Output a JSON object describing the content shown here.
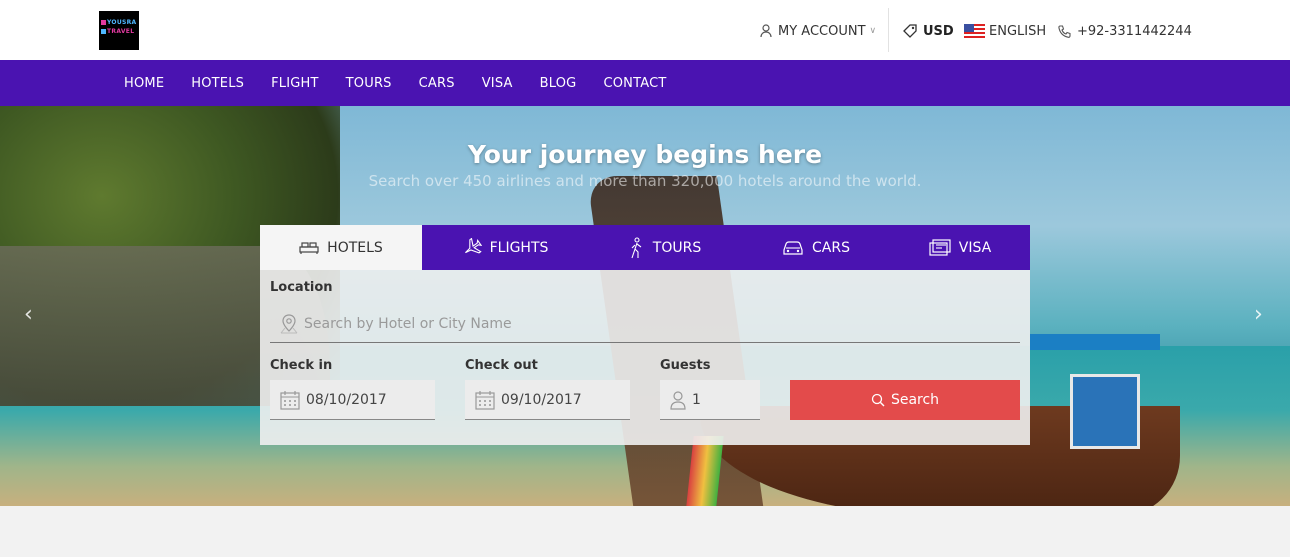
{
  "brand": {
    "line1": "YOUSRA",
    "line2": "TRAVEL"
  },
  "header": {
    "account_label": "MY ACCOUNT",
    "currency": "USD",
    "language": "ENGLISH",
    "phone": "+92-3311442244"
  },
  "nav": {
    "items": [
      {
        "label": "HOME"
      },
      {
        "label": "HOTELS"
      },
      {
        "label": "FLIGHT"
      },
      {
        "label": "TOURS"
      },
      {
        "label": "CARS"
      },
      {
        "label": "VISA"
      },
      {
        "label": "BLOG"
      },
      {
        "label": "CONTACT"
      }
    ]
  },
  "hero": {
    "title": "Your journey begins here",
    "subtitle": "Search over 450 airlines and more than 320,000 hotels around the world."
  },
  "search": {
    "tabs": [
      {
        "label": "HOTELS",
        "icon": "bed-icon"
      },
      {
        "label": "FLIGHTS",
        "icon": "plane-icon"
      },
      {
        "label": "TOURS",
        "icon": "hiker-icon"
      },
      {
        "label": "CARS",
        "icon": "car-icon"
      },
      {
        "label": "VISA",
        "icon": "card-icon"
      }
    ],
    "location_label": "Location",
    "location_placeholder": "Search by Hotel or City Name",
    "checkin_label": "Check in",
    "checkin_value": "08/10/2017",
    "checkout_label": "Check out",
    "checkout_value": "09/10/2017",
    "guests_label": "Guests",
    "guests_value": "1",
    "search_label": "Search"
  },
  "colors": {
    "primary": "#4a13b1",
    "search_button": "#e34b4b"
  }
}
